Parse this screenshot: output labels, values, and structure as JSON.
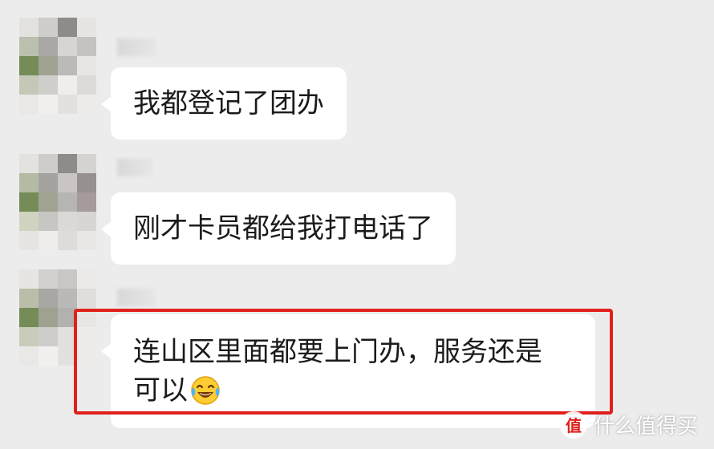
{
  "conversation": {
    "messages": [
      {
        "text": "我都登记了团办"
      },
      {
        "text": "刚才卡员都给我打电话了"
      },
      {
        "line1": "连山区里面都要上门办，服务还是",
        "line2": "可以",
        "emoji": "laughing-tears-emoji"
      }
    ]
  },
  "watermark": {
    "logo_glyph": "值",
    "text": "什么值得买"
  },
  "colors": {
    "background": "#ececec",
    "bubble": "#ffffff",
    "highlight": "#e0201b"
  }
}
